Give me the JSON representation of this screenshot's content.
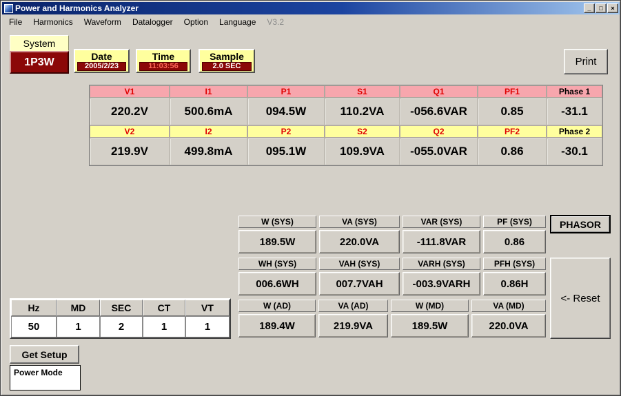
{
  "window": {
    "title": "Power and Harmonics Analyzer",
    "controls": {
      "minimize": "_",
      "maximize": "□",
      "close": "×"
    }
  },
  "menu": {
    "items": [
      "File",
      "Harmonics",
      "Waveform",
      "Datalogger",
      "Option",
      "Language"
    ],
    "version": "V3.2"
  },
  "topbar": {
    "system": {
      "label": "System",
      "value": "1P3W"
    },
    "date": {
      "label": "Date",
      "value": "2005/2/23"
    },
    "time": {
      "label": "Time",
      "value": "11:03:56"
    },
    "sample": {
      "label": "Sample",
      "value": "2.0 SEC"
    },
    "print": "Print"
  },
  "phase_table": {
    "row1": {
      "headers": [
        "V1",
        "I1",
        "P1",
        "S1",
        "Q1",
        "PF1",
        "Phase 1"
      ],
      "values": [
        "220.2V",
        "500.6mA",
        "094.5W",
        "110.2VA",
        "-056.6VAR",
        "0.85",
        "-31.1"
      ]
    },
    "row2": {
      "headers": [
        "V2",
        "I2",
        "P2",
        "S2",
        "Q2",
        "PF2",
        "Phase 2"
      ],
      "values": [
        "219.9V",
        "499.8mA",
        "095.1W",
        "109.9VA",
        "-055.0VAR",
        "0.86",
        "-30.1"
      ]
    }
  },
  "sys_panel": {
    "group1": {
      "headers": [
        "W (SYS)",
        "VA (SYS)",
        "VAR (SYS)",
        "PF (SYS)"
      ],
      "values": [
        "189.5W",
        "220.0VA",
        "-111.8VAR",
        "0.86"
      ]
    },
    "group2": {
      "headers": [
        "WH (SYS)",
        "VAH (SYS)",
        "VARH (SYS)",
        "PFH (SYS)"
      ],
      "values": [
        "006.6WH",
        "007.7VAH",
        "-003.9VARH",
        "0.86H"
      ]
    },
    "group3": {
      "headers": [
        "W (AD)",
        "VA (AD)",
        "W (MD)",
        "VA (MD)"
      ],
      "values": [
        "189.4W",
        "219.9VA",
        "189.5W",
        "220.0VA"
      ]
    }
  },
  "side_buttons": {
    "phasor": "PHASOR",
    "reset": "<- Reset"
  },
  "settings": {
    "headers": [
      "Hz",
      "MD",
      "SEC",
      "CT",
      "VT"
    ],
    "values": [
      "50",
      "1",
      "2",
      "1",
      "1"
    ]
  },
  "bottom": {
    "get_setup": "Get Setup",
    "power_mode": "Power Mode"
  },
  "colors": {
    "chrome": "#d4d0c8",
    "accent_maroon": "#8b0808",
    "header_pink": "#f7a6ad",
    "header_yellow": "#ffff9e",
    "header_text_red": "#e00000",
    "titlebar_blue": "#0a246a"
  }
}
